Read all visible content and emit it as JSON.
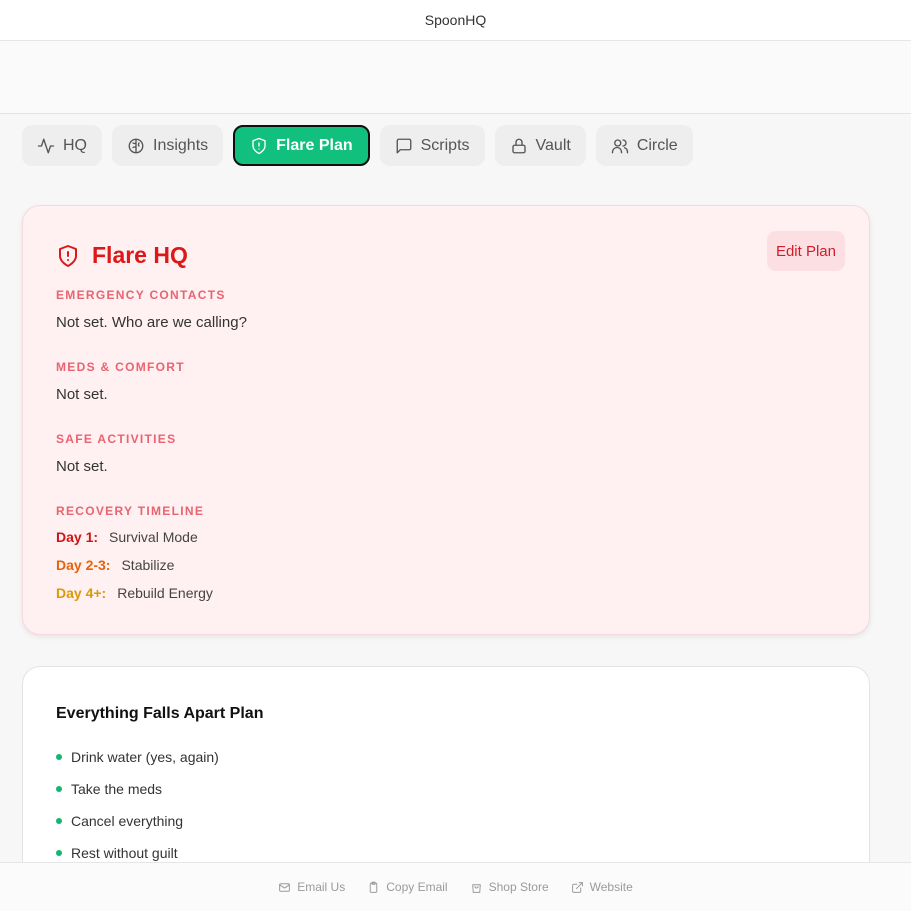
{
  "window": {
    "title": "SpoonHQ"
  },
  "tabs": [
    {
      "label": "HQ",
      "icon": "activity-icon",
      "active": false
    },
    {
      "label": "Insights",
      "icon": "brain-icon",
      "active": false
    },
    {
      "label": "Flare Plan",
      "icon": "shield-alert-icon",
      "active": true
    },
    {
      "label": "Scripts",
      "icon": "message-square-icon",
      "active": false
    },
    {
      "label": "Vault",
      "icon": "lock-icon",
      "active": false
    },
    {
      "label": "Circle",
      "icon": "users-icon",
      "active": false
    }
  ],
  "flare": {
    "title": "Flare HQ",
    "edit_label": "Edit Plan",
    "sections": [
      {
        "label": "EMERGENCY CONTACTS",
        "value": "Not set. Who are we calling?"
      },
      {
        "label": "MEDS & COMFORT",
        "value": "Not set."
      },
      {
        "label": "SAFE ACTIVITIES",
        "value": "Not set."
      }
    ],
    "timeline_label": "RECOVERY TIMELINE",
    "timeline": [
      {
        "day": "Day 1:",
        "text": "Survival Mode",
        "color": "#d11414"
      },
      {
        "day": "Day 2-3:",
        "text": "Stabilize",
        "color": "#e8620c"
      },
      {
        "day": "Day 4+:",
        "text": "Rebuild Energy",
        "color": "#d99a06"
      }
    ]
  },
  "plan": {
    "title": "Everything Falls Apart Plan",
    "items": [
      "Drink water (yes, again)",
      "Take the meds",
      "Cancel everything",
      "Rest without guilt"
    ]
  },
  "footer": {
    "links": [
      {
        "label": "Email Us",
        "icon": "mail-icon"
      },
      {
        "label": "Copy Email",
        "icon": "clipboard-icon"
      },
      {
        "label": "Shop Store",
        "icon": "shopping-bag-icon"
      },
      {
        "label": "Website",
        "icon": "external-link-icon"
      }
    ]
  },
  "colors": {
    "accent": "#12c07e",
    "flare_red": "#dc1818",
    "flare_bg": "#fff0f1"
  }
}
